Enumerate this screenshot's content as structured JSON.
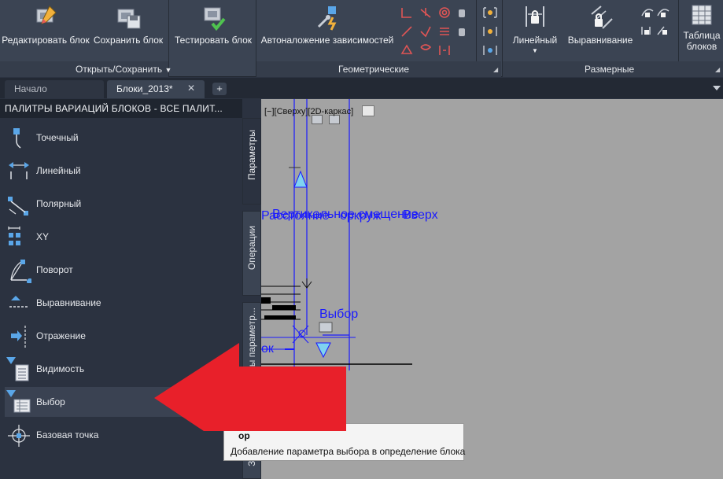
{
  "ribbon": {
    "buttons": {
      "edit_block": "Редактировать блок",
      "save_block": "Сохранить блок",
      "test_block": "Тестировать блок",
      "auto_constraint": "Автоналожение зависимостей",
      "linear": "Линейный",
      "align": "Выравнивание",
      "block_table_line1": "Таблица",
      "block_table_line2": "блоков"
    },
    "panels": {
      "open_save": "Открыть/Сохранить",
      "geometric": "Геометрические",
      "dimensional": "Размерные"
    }
  },
  "tabs": {
    "start": "Начало",
    "blocks": "Блоки_2013*",
    "close_glyph": "✕",
    "add_glyph": "+"
  },
  "palette": {
    "title": "ПАЛИТРЫ ВАРИАЦИЙ БЛОКОВ - ВСЕ ПАЛИТ...",
    "items": [
      {
        "label": "Точечный",
        "icon": "point-parameter-icon"
      },
      {
        "label": "Линейный",
        "icon": "linear-parameter-icon"
      },
      {
        "label": "Полярный",
        "icon": "polar-parameter-icon"
      },
      {
        "label": "XY",
        "icon": "xy-parameter-icon"
      },
      {
        "label": "Поворот",
        "icon": "rotation-parameter-icon"
      },
      {
        "label": "Выравнивание",
        "icon": "alignment-parameter-icon"
      },
      {
        "label": "Отражение",
        "icon": "flip-parameter-icon"
      },
      {
        "label": "Видимость",
        "icon": "visibility-parameter-icon"
      },
      {
        "label": "Выбор",
        "icon": "lookup-parameter-icon"
      },
      {
        "label": "Базовая точка",
        "icon": "basepoint-parameter-icon"
      }
    ],
    "side_tabs": {
      "parameters": "Параметры",
      "actions": "Операции",
      "param_sets": "Наборы параметр...",
      "constraints": "За"
    }
  },
  "canvas": {
    "view_label": "[−][Сверху][2D-каркас]",
    "labels": {
      "overlap": "Расстояние",
      "overlap2": "Вертикальное смещение",
      "overlap3": "оркруж",
      "up": "Вверх",
      "lookup": "Выбор",
      "left_text": "ок"
    }
  },
  "tooltip": {
    "title": "Выбор",
    "title_visible": "ор",
    "description": "Добавление параметра выбора в определение блока",
    "description_visible": "Добавление параметра выбора в определение блока"
  },
  "colors": {
    "accent": "#5aa6e8",
    "dim_blue": "#2233ee",
    "arrow_red": "#e8202a"
  }
}
